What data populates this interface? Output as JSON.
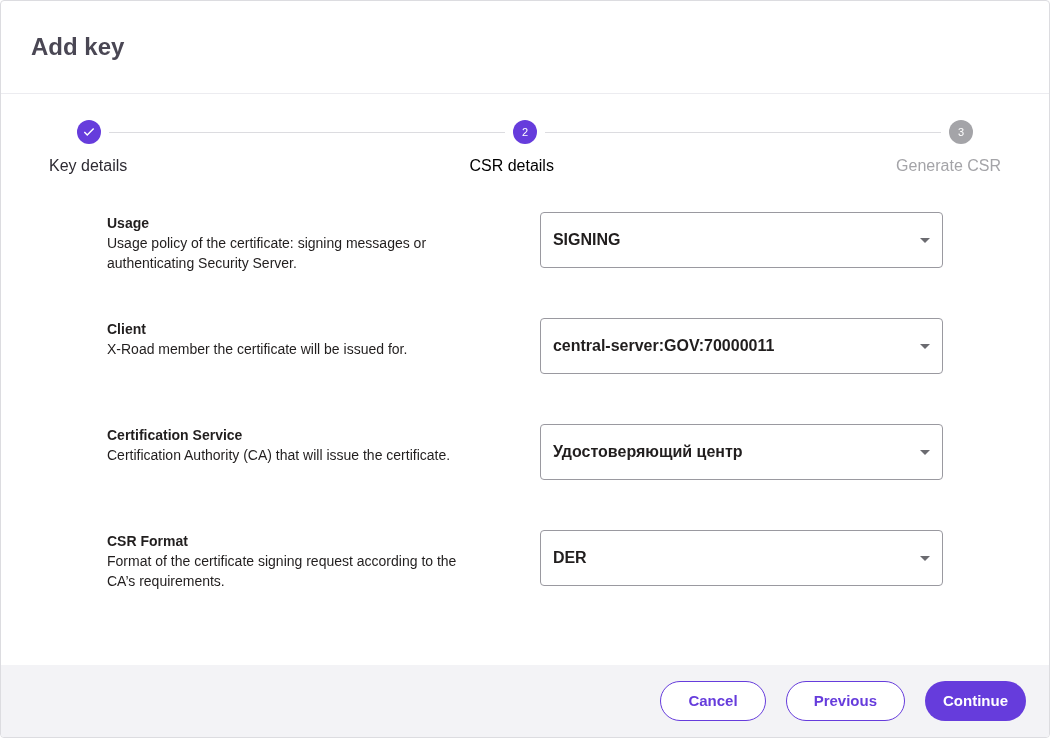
{
  "dialog": {
    "title": "Add key"
  },
  "steps": [
    {
      "label": "Key details",
      "completed": true,
      "active": false
    },
    {
      "label": "CSR details",
      "number": "2",
      "completed": false,
      "active": true
    },
    {
      "label": "Generate CSR",
      "number": "3",
      "completed": false,
      "active": false
    }
  ],
  "fields": [
    {
      "label": "Usage",
      "description": "Usage policy of the certificate: signing messages or authenticating Security Server.",
      "value": "SIGNING"
    },
    {
      "label": "Client",
      "description": "X-Road member the certificate will be issued for.",
      "value": "central-server:GOV:70000011"
    },
    {
      "label": "Certification Service",
      "description": "Certification Authority (CA) that will issue the certificate.",
      "value": "Удостоверяющий центр"
    },
    {
      "label": "CSR Format",
      "description": "Format of the certificate signing request according to the CA’s requirements.",
      "value": "DER"
    }
  ],
  "buttons": [
    {
      "label": "Cancel",
      "kind": "outlined"
    },
    {
      "label": "Previous",
      "kind": "outlined"
    },
    {
      "label": "Continue",
      "kind": "filled"
    }
  ]
}
